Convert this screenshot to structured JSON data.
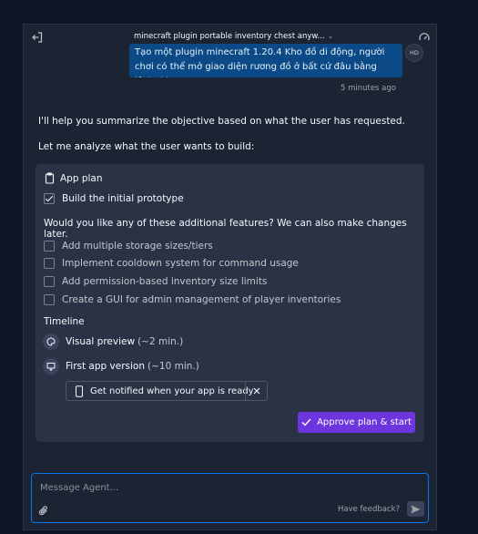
{
  "header": {
    "title": "minecraft plugin portable inventory chest anyw...",
    "chevron": "⌄"
  },
  "user_message": {
    "text": "Tạo một plugin minecraft 1.20.4 Kho đồ di động, người chơi có thể mở giao diện rương đồ ở bất cứ đâu bằng lệnh /kho",
    "avatar": "HD",
    "timestamp": "5 minutes ago"
  },
  "agent": {
    "para1": "I'll help you summarize the objective based on what the user has requested.",
    "para2": "Let me analyze what the user wants to build:"
  },
  "plan": {
    "heading": "App plan",
    "prototype": "Build the initial prototype",
    "question": "Would you like any of these additional features? We can also make changes later.",
    "options": [
      "Add multiple storage sizes/tiers",
      "Implement cooldown system for command usage",
      "Add permission-based inventory size limits",
      "Create a GUI for admin management of player inventories"
    ],
    "timeline_label": "Timeline",
    "timeline": [
      {
        "label": "Visual preview",
        "duration": "(~2 min.)"
      },
      {
        "label": "First app version",
        "duration": "(~10 min.)"
      }
    ],
    "notify": "Get notified when your app is ready",
    "approve": "Approve plan & start"
  },
  "composer": {
    "placeholder": "Message Agent...",
    "feedback": "Have feedback?"
  },
  "colors": {
    "background": "#0e1525",
    "panel": "#1c2333",
    "card": "#2b3245",
    "user_bubble": "#0b4a86",
    "accent": "#6d35de",
    "focus": "#0079f2"
  }
}
